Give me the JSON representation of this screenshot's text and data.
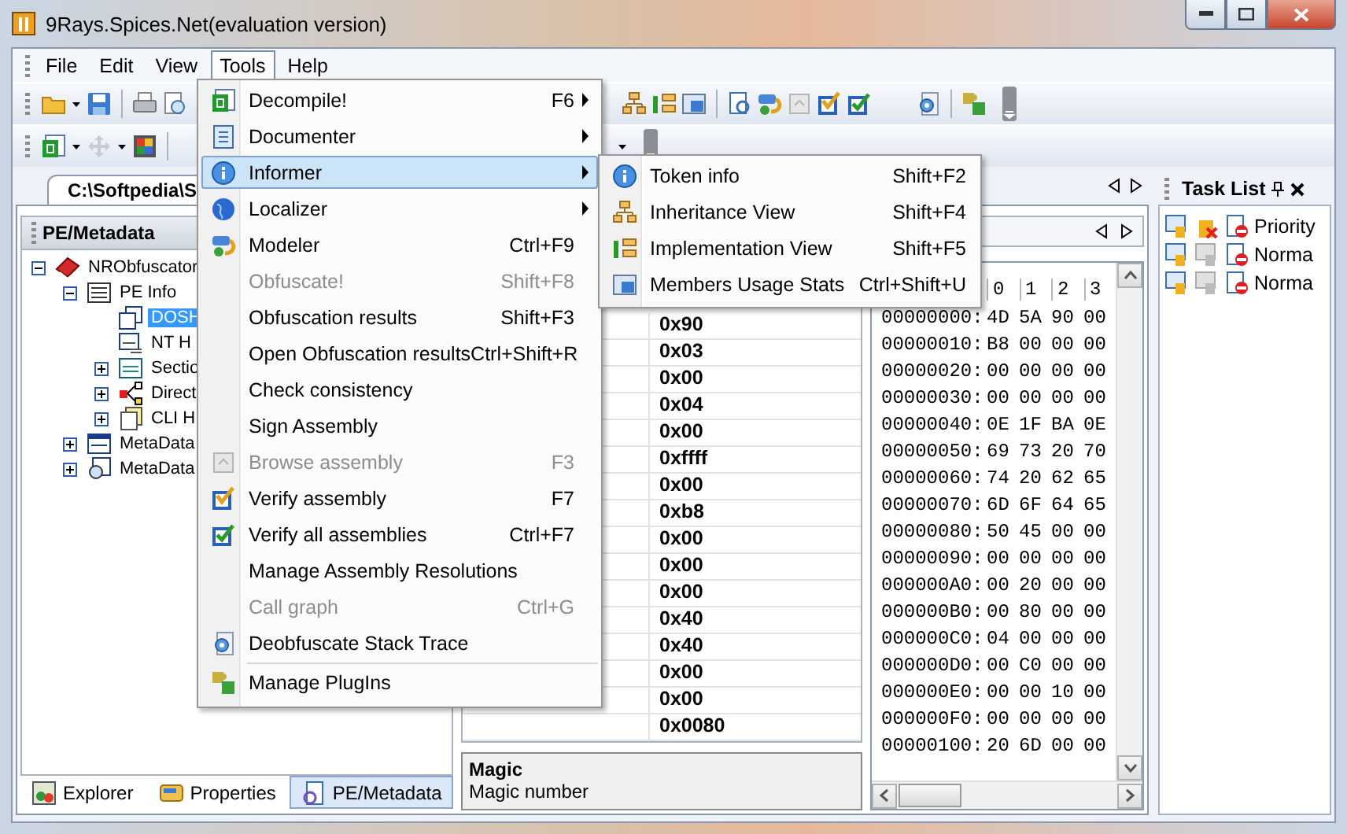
{
  "window": {
    "title": "9Rays.Spices.Net(evaluation version)"
  },
  "menu_bar": [
    {
      "label": "File",
      "selected": false
    },
    {
      "label": "Edit",
      "selected": false
    },
    {
      "label": "View",
      "selected": false
    },
    {
      "label": "Tools",
      "selected": true
    },
    {
      "label": "Help",
      "selected": false
    }
  ],
  "tools_menu": [
    {
      "label": "Decompile!",
      "shortcut": "F6",
      "submenu": true,
      "disabled": false,
      "selected": false,
      "separator_before": false
    },
    {
      "label": "Documenter",
      "submenu": true,
      "disabled": false,
      "selected": false,
      "separator_before": false
    },
    {
      "label": "Informer",
      "submenu": true,
      "disabled": false,
      "selected": true,
      "separator_before": false
    },
    {
      "label": "Localizer",
      "submenu": true,
      "disabled": false,
      "selected": false,
      "separator_before": false
    },
    {
      "label": "Modeler",
      "shortcut": "Ctrl+F9",
      "submenu": false,
      "disabled": false,
      "selected": false,
      "separator_before": false
    },
    {
      "label": "Obfuscate!",
      "shortcut": "Shift+F8",
      "submenu": false,
      "disabled": true,
      "selected": false,
      "separator_before": false
    },
    {
      "label": "Obfuscation results",
      "shortcut": "Shift+F3",
      "submenu": false,
      "disabled": false,
      "selected": false,
      "separator_before": false
    },
    {
      "label": "Open Obfuscation results",
      "shortcut": "Ctrl+Shift+R",
      "submenu": false,
      "disabled": false,
      "selected": false,
      "separator_before": false
    },
    {
      "label": "Check consistency",
      "submenu": false,
      "disabled": false,
      "selected": false,
      "separator_before": false
    },
    {
      "label": "Sign Assembly",
      "submenu": false,
      "disabled": false,
      "selected": false,
      "separator_before": false
    },
    {
      "label": "Browse assembly",
      "shortcut": "F3",
      "submenu": false,
      "disabled": true,
      "selected": false,
      "separator_before": false
    },
    {
      "label": "Verify assembly",
      "shortcut": "F7",
      "submenu": false,
      "disabled": false,
      "selected": false,
      "separator_before": false
    },
    {
      "label": "Verify all assemblies",
      "shortcut": "Ctrl+F7",
      "submenu": false,
      "disabled": false,
      "selected": false,
      "separator_before": false
    },
    {
      "label": "Manage Assembly Resolutions",
      "submenu": false,
      "disabled": false,
      "selected": false,
      "separator_before": false
    },
    {
      "label": "Call graph",
      "shortcut": "Ctrl+G",
      "submenu": false,
      "disabled": true,
      "selected": false,
      "separator_before": false
    },
    {
      "label": "Deobfuscate Stack Trace",
      "submenu": false,
      "disabled": false,
      "selected": false,
      "separator_before": false
    },
    {
      "label": "Manage PlugIns",
      "submenu": false,
      "disabled": false,
      "selected": false,
      "separator_before": true
    }
  ],
  "informer_menu": [
    {
      "label": "Token info",
      "shortcut": "Shift+F2"
    },
    {
      "label": "Inheritance View",
      "shortcut": "Shift+F4"
    },
    {
      "label": "Implementation View",
      "shortcut": "Shift+F5"
    },
    {
      "label": "Members Usage Stats",
      "shortcut": "Ctrl+Shift+U"
    }
  ],
  "document_tab": {
    "label": "C:\\Softpedia\\S"
  },
  "left_panel": {
    "title": "PE/Metadata",
    "tree": [
      {
        "label": "NRObfuscator",
        "selected": false,
        "expanded": true,
        "children": [
          {
            "label": "PE Info",
            "selected": false,
            "expanded": true,
            "children": [
              {
                "label": "DOSH",
                "selected": true
              },
              {
                "label": "NT H",
                "selected": false
              },
              {
                "label": "Sectio",
                "selected": false,
                "expanded": false
              },
              {
                "label": "Direct",
                "selected": false,
                "expanded": false
              },
              {
                "label": "CLI H",
                "selected": false,
                "expanded": false
              }
            ]
          },
          {
            "label": "MetaData",
            "selected": false,
            "expanded": false
          },
          {
            "label": "MetaData",
            "selected": false,
            "expanded": false
          }
        ]
      }
    ]
  },
  "bottom_tabs": [
    {
      "label": "Explorer",
      "selected": false
    },
    {
      "label": "Properties",
      "selected": false
    },
    {
      "label": "PE/Metadata",
      "selected": true
    }
  ],
  "field_values": [
    "0x90",
    "0x03",
    "0x00",
    "0x04",
    "0x00",
    "0xffff",
    "0x00",
    "0xb8",
    "0x00",
    "0x00",
    "0x00",
    "0x40",
    "0x40",
    "0x00",
    "0x00",
    "0x0080"
  ],
  "description": {
    "title": "Magic",
    "text": "Magic number"
  },
  "hex_view": {
    "columns": [
      "0",
      "1",
      "2",
      "3"
    ],
    "rows": [
      {
        "offset": "00000000:",
        "bytes": [
          "4D",
          "5A",
          "90",
          "00"
        ]
      },
      {
        "offset": "00000010:",
        "bytes": [
          "B8",
          "00",
          "00",
          "00"
        ]
      },
      {
        "offset": "00000020:",
        "bytes": [
          "00",
          "00",
          "00",
          "00"
        ]
      },
      {
        "offset": "00000030:",
        "bytes": [
          "00",
          "00",
          "00",
          "00"
        ]
      },
      {
        "offset": "00000040:",
        "bytes": [
          "0E",
          "1F",
          "BA",
          "0E"
        ]
      },
      {
        "offset": "00000050:",
        "bytes": [
          "69",
          "73",
          "20",
          "70"
        ]
      },
      {
        "offset": "00000060:",
        "bytes": [
          "74",
          "20",
          "62",
          "65"
        ]
      },
      {
        "offset": "00000070:",
        "bytes": [
          "6D",
          "6F",
          "64",
          "65"
        ]
      },
      {
        "offset": "00000080:",
        "bytes": [
          "50",
          "45",
          "00",
          "00"
        ]
      },
      {
        "offset": "00000090:",
        "bytes": [
          "00",
          "00",
          "00",
          "00"
        ]
      },
      {
        "offset": "000000A0:",
        "bytes": [
          "00",
          "20",
          "00",
          "00"
        ]
      },
      {
        "offset": "000000B0:",
        "bytes": [
          "00",
          "80",
          "00",
          "00"
        ]
      },
      {
        "offset": "000000C0:",
        "bytes": [
          "04",
          "00",
          "00",
          "00"
        ]
      },
      {
        "offset": "000000D0:",
        "bytes": [
          "00",
          "C0",
          "00",
          "00"
        ]
      },
      {
        "offset": "000000E0:",
        "bytes": [
          "00",
          "00",
          "10",
          "00"
        ]
      },
      {
        "offset": "000000F0:",
        "bytes": [
          "00",
          "00",
          "00",
          "00"
        ]
      },
      {
        "offset": "00000100:",
        "bytes": [
          "20",
          "6D",
          "00",
          "00"
        ]
      }
    ]
  },
  "task_list": {
    "title": "Task List",
    "header": "Priority",
    "rows": [
      "Norma",
      "Norma"
    ]
  }
}
